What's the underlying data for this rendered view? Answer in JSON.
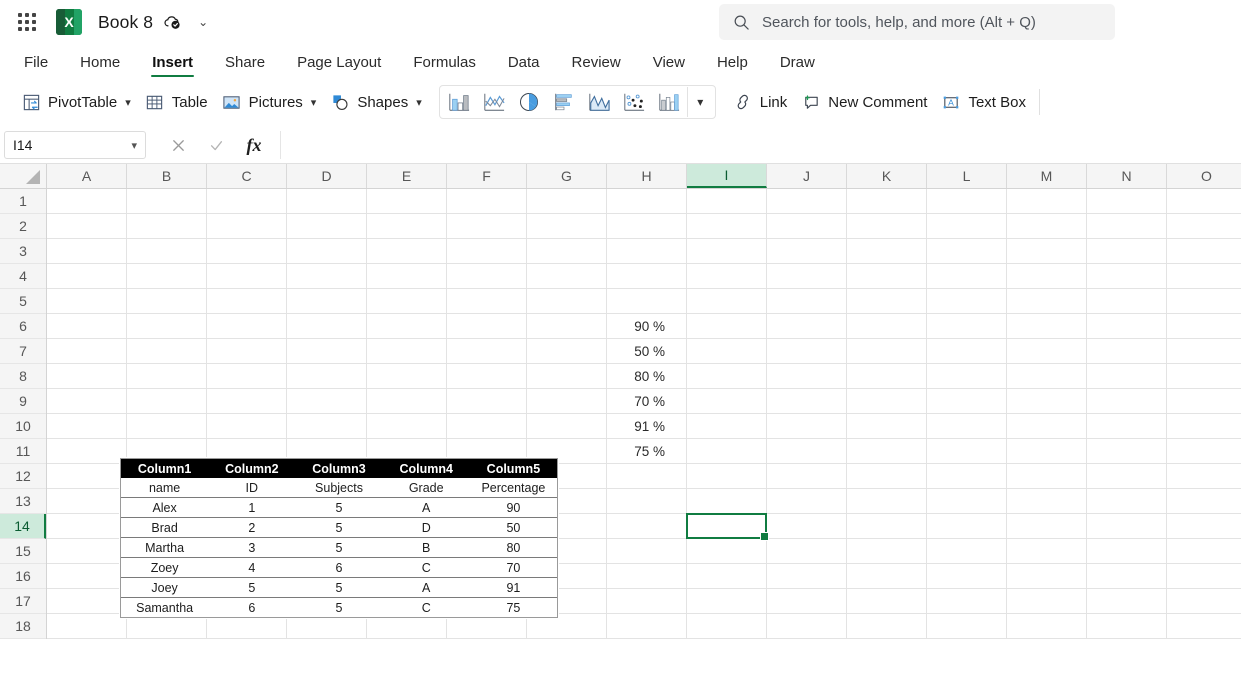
{
  "titlebar": {
    "app_icon": "excel-logo",
    "app_letter": "X",
    "waffle_icon": "app-launcher-icon",
    "document_title": "Book 8",
    "cloud_icon": "cloud-saved-icon",
    "title_caret": "chevron-down-icon",
    "caret_glyph": "⌄"
  },
  "search": {
    "icon": "search-icon",
    "placeholder": "Search for tools, help, and more (Alt + Q)"
  },
  "tabs": [
    {
      "label": "File",
      "active": false
    },
    {
      "label": "Home",
      "active": false
    },
    {
      "label": "Insert",
      "active": true
    },
    {
      "label": "Share",
      "active": false
    },
    {
      "label": "Page Layout",
      "active": false
    },
    {
      "label": "Formulas",
      "active": false
    },
    {
      "label": "Data",
      "active": false
    },
    {
      "label": "Review",
      "active": false
    },
    {
      "label": "View",
      "active": false
    },
    {
      "label": "Help",
      "active": false
    },
    {
      "label": "Draw",
      "active": false
    }
  ],
  "ribbon": {
    "items": [
      {
        "label": "PivotTable",
        "icon": "pivottable-icon",
        "caret": true
      },
      {
        "label": "Table",
        "icon": "table-icon",
        "caret": false
      },
      {
        "label": "Pictures",
        "icon": "pictures-icon",
        "caret": true
      },
      {
        "label": "Shapes",
        "icon": "shapes-icon",
        "caret": true
      }
    ],
    "charts": [
      {
        "name": "column-chart-icon",
        "title": "Column"
      },
      {
        "name": "line-chart-icon",
        "title": "Line"
      },
      {
        "name": "pie-chart-icon",
        "title": "Pie"
      },
      {
        "name": "bar-chart-icon",
        "title": "Bar"
      },
      {
        "name": "area-chart-icon",
        "title": "Area"
      },
      {
        "name": "scatter-chart-icon",
        "title": "Scatter"
      },
      {
        "name": "combo-chart-icon",
        "title": "Combo"
      }
    ],
    "charts_more_caret": "chevron-down-icon",
    "right_items": [
      {
        "label": "Link",
        "icon": "link-icon"
      },
      {
        "label": "New Comment",
        "icon": "new-comment-icon"
      },
      {
        "label": "Text Box",
        "icon": "text-box-icon"
      }
    ]
  },
  "formula_bar": {
    "name_box_value": "I14",
    "name_box_caret": "chevron-down-icon",
    "cancel_icon": "cancel-icon",
    "enter_icon": "enter-check-icon",
    "function_icon": "fx-icon",
    "function_glyph": "fx",
    "formula_value": ""
  },
  "grid": {
    "columns": [
      "A",
      "B",
      "C",
      "D",
      "E",
      "F",
      "G",
      "H",
      "I",
      "J",
      "K",
      "L",
      "M",
      "N",
      "O"
    ],
    "rows": [
      1,
      2,
      3,
      4,
      5,
      6,
      7,
      8,
      9,
      10,
      11,
      12,
      13,
      14,
      15,
      16,
      17,
      18
    ],
    "selected_cell": "I14",
    "selected_column": "I",
    "selected_row": 14,
    "selection_color": "#107c41",
    "header_select_color": "#cdeadb",
    "column_h_values": [
      {
        "row": 6,
        "text": "90 %"
      },
      {
        "row": 7,
        "text": "50 %"
      },
      {
        "row": 8,
        "text": "80 %"
      },
      {
        "row": 9,
        "text": "70 %"
      },
      {
        "row": 10,
        "text": "91 %"
      },
      {
        "row": 11,
        "text": "75 %"
      }
    ]
  },
  "embedded_table": {
    "header": [
      "Column1",
      "Column2",
      "Column3",
      "Column4",
      "Column5"
    ],
    "subheader": [
      "name",
      "ID",
      "Subjects",
      "Grade",
      "Percentage"
    ],
    "rows": [
      [
        "Alex",
        "1",
        "5",
        "A",
        "90"
      ],
      [
        "Brad",
        "2",
        "5",
        "D",
        "50"
      ],
      [
        "Martha",
        "3",
        "5",
        "B",
        "80"
      ],
      [
        "Zoey",
        "4",
        "6",
        "C",
        "70"
      ],
      [
        "Joey",
        "5",
        "5",
        "A",
        "91"
      ],
      [
        "Samantha",
        "6",
        "5",
        "C",
        "75"
      ]
    ],
    "header_bg": "#000000",
    "header_fg": "#ffffff"
  }
}
